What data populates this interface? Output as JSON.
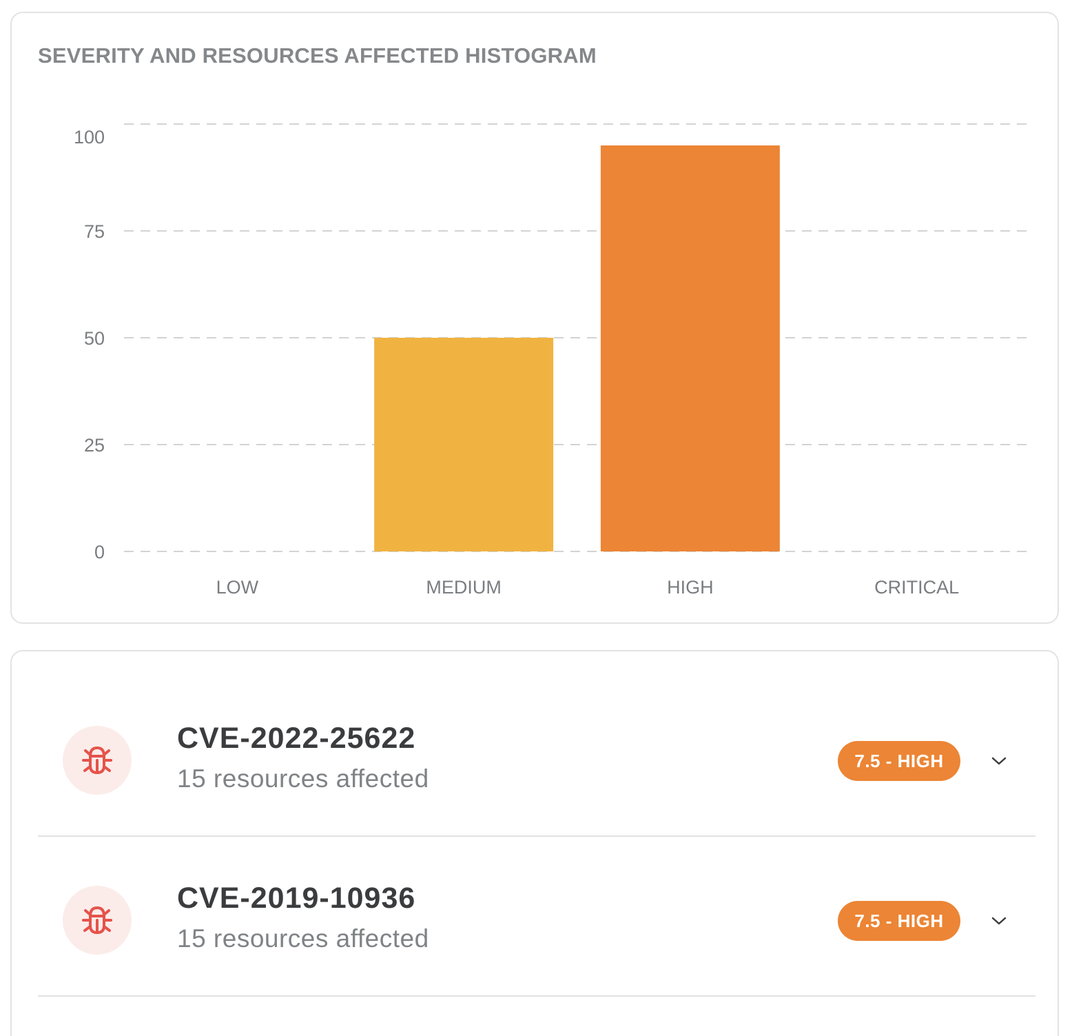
{
  "chart_card": {
    "title": "SEVERITY AND RESOURCES AFFECTED HISTOGRAM"
  },
  "chart_data": {
    "type": "bar",
    "title": "SEVERITY AND RESOURCES AFFECTED HISTOGRAM",
    "xlabel": "",
    "ylabel": "",
    "categories": [
      "LOW",
      "MEDIUM",
      "HIGH",
      "CRITICAL"
    ],
    "values": [
      0,
      50,
      95,
      0
    ],
    "colors": [
      "#f0b342",
      "#f0b342",
      "#ec8535",
      "#e5533d"
    ],
    "ylim": [
      0,
      100
    ],
    "yticks": [
      0,
      25,
      50,
      75,
      100
    ],
    "grid": true,
    "legend": "none"
  },
  "cve_list": {
    "items": [
      {
        "id": "CVE-2022-25622",
        "resources": "15 resources affected",
        "badge": "7.5 - HIGH",
        "icon": "bug-icon",
        "badge_color": "#ec8535"
      },
      {
        "id": "CVE-2019-10936",
        "resources": "15 resources affected",
        "badge": "7.5 - HIGH",
        "icon": "bug-icon",
        "badge_color": "#ec8535"
      }
    ]
  }
}
